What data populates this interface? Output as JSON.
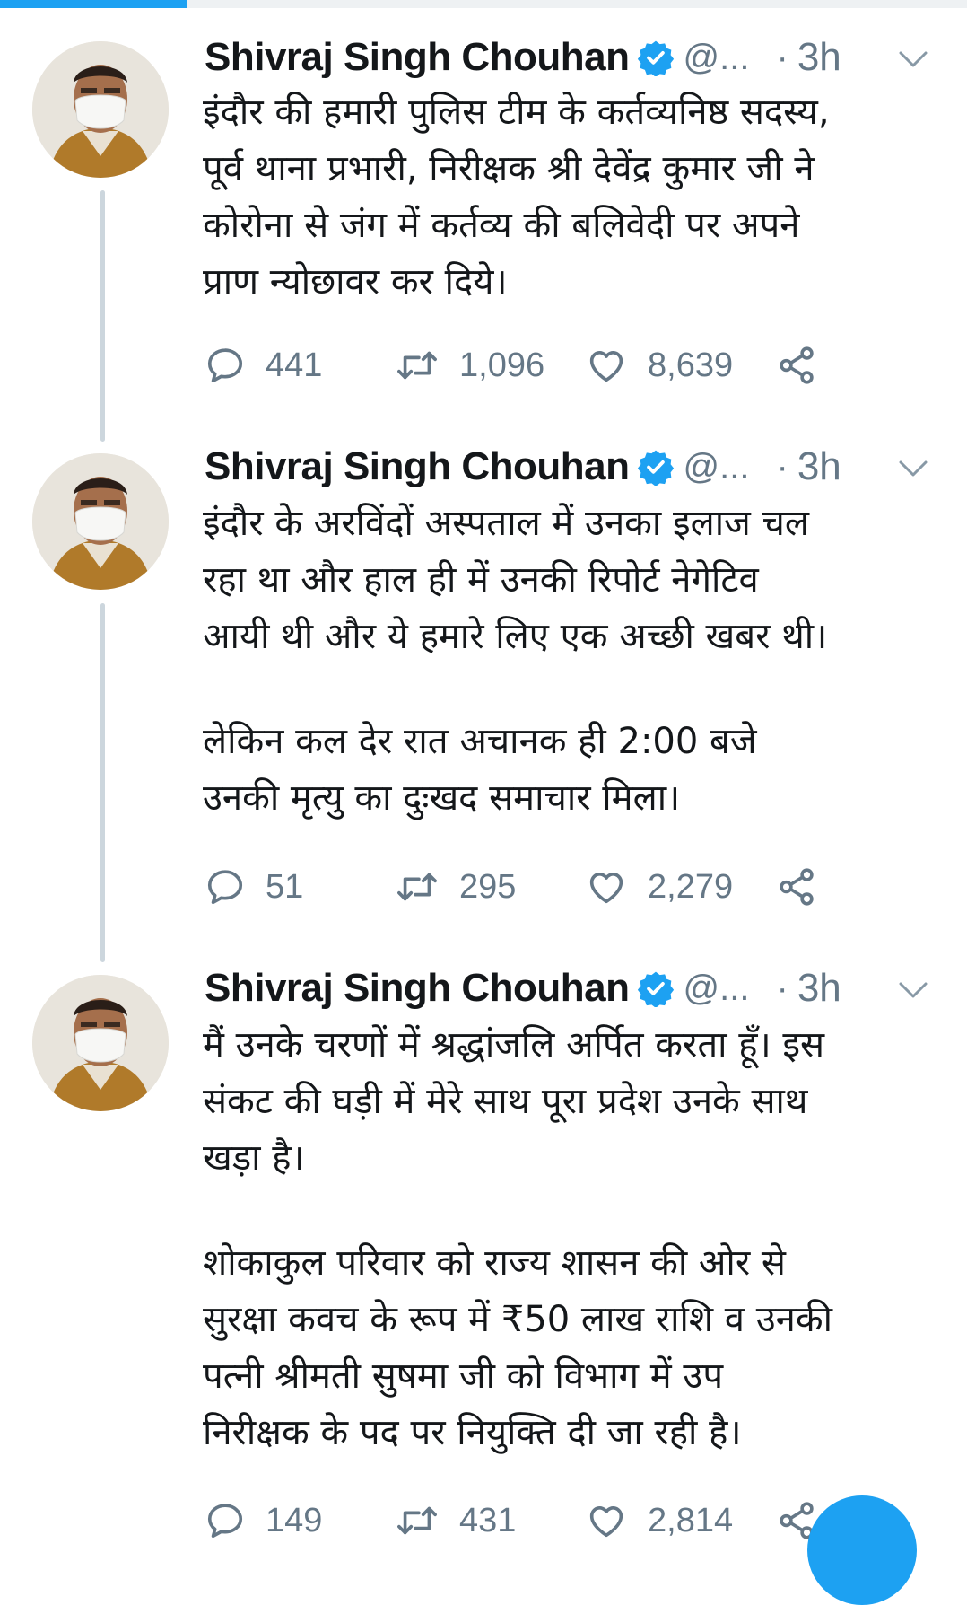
{
  "progress": {
    "fraction": 0.194,
    "color": "#1da1f2"
  },
  "tweets": [
    {
      "name": "Shivraj Singh Chouhan",
      "handle": "@...",
      "separator": "·",
      "time": "3h",
      "paragraphs": [
        [
          "इंदौर की हमारी पुलिस टीम के कर्तव्यनिष्ठ सदस्य,",
          "पूर्व थाना प्रभारी, निरीक्षक श्री देवेंद्र कुमार जी ने",
          "कोरोना से जंग में कर्तव्य की बलिवेदी पर अपने",
          "प्राण न्योछावर कर दिये।"
        ]
      ],
      "replies": "441",
      "retweets": "1,096",
      "likes": "8,639"
    },
    {
      "name": "Shivraj Singh Chouhan",
      "handle": "@...",
      "separator": "·",
      "time": "3h",
      "paragraphs": [
        [
          "इंदौर के अरविंदों अस्पताल में उनका इलाज चल",
          "रहा था और हाल ही में उनकी रिपोर्ट नेगेटिव",
          "आयी थी और ये हमारे लिए एक अच्छी खबर थी।"
        ],
        [
          "लेकिन कल देर रात अचानक ही 2:00 बजे",
          "उनकी मृत्यु का दुःखद समाचार मिला।"
        ]
      ],
      "replies": "51",
      "retweets": "295",
      "likes": "2,279"
    },
    {
      "name": "Shivraj Singh Chouhan",
      "handle": "@...",
      "separator": "·",
      "time": "3h",
      "paragraphs": [
        [
          "मैं उनके चरणों में श्रद्धांजलि अर्पित करता हूँ। इस",
          "संकट की घड़ी में मेरे साथ पूरा प्रदेश उनके साथ",
          "खड़ा है।"
        ],
        [
          "शोकाकुल परिवार को राज्य शासन की ओर से",
          "सुरक्षा कवच के रूप में ₹50 लाख राशि व उनकी",
          "पत्नी श्रीमती सुषमा जी को विभाग में उप",
          "निरीक्षक के पद पर नियुक्ति दी जा रही है।"
        ]
      ],
      "replies": "149",
      "retweets": "431",
      "likes": "2,814"
    }
  ],
  "icons": {
    "verified": "verified-badge-icon",
    "caret": "chevron-down-icon",
    "reply": "reply-icon",
    "retweet": "retweet-icon",
    "like": "heart-icon",
    "share": "share-icon"
  },
  "colors": {
    "accent": "#1da1f2",
    "muted": "#657786",
    "text": "#14171a",
    "thread": "#ccd6dd"
  }
}
